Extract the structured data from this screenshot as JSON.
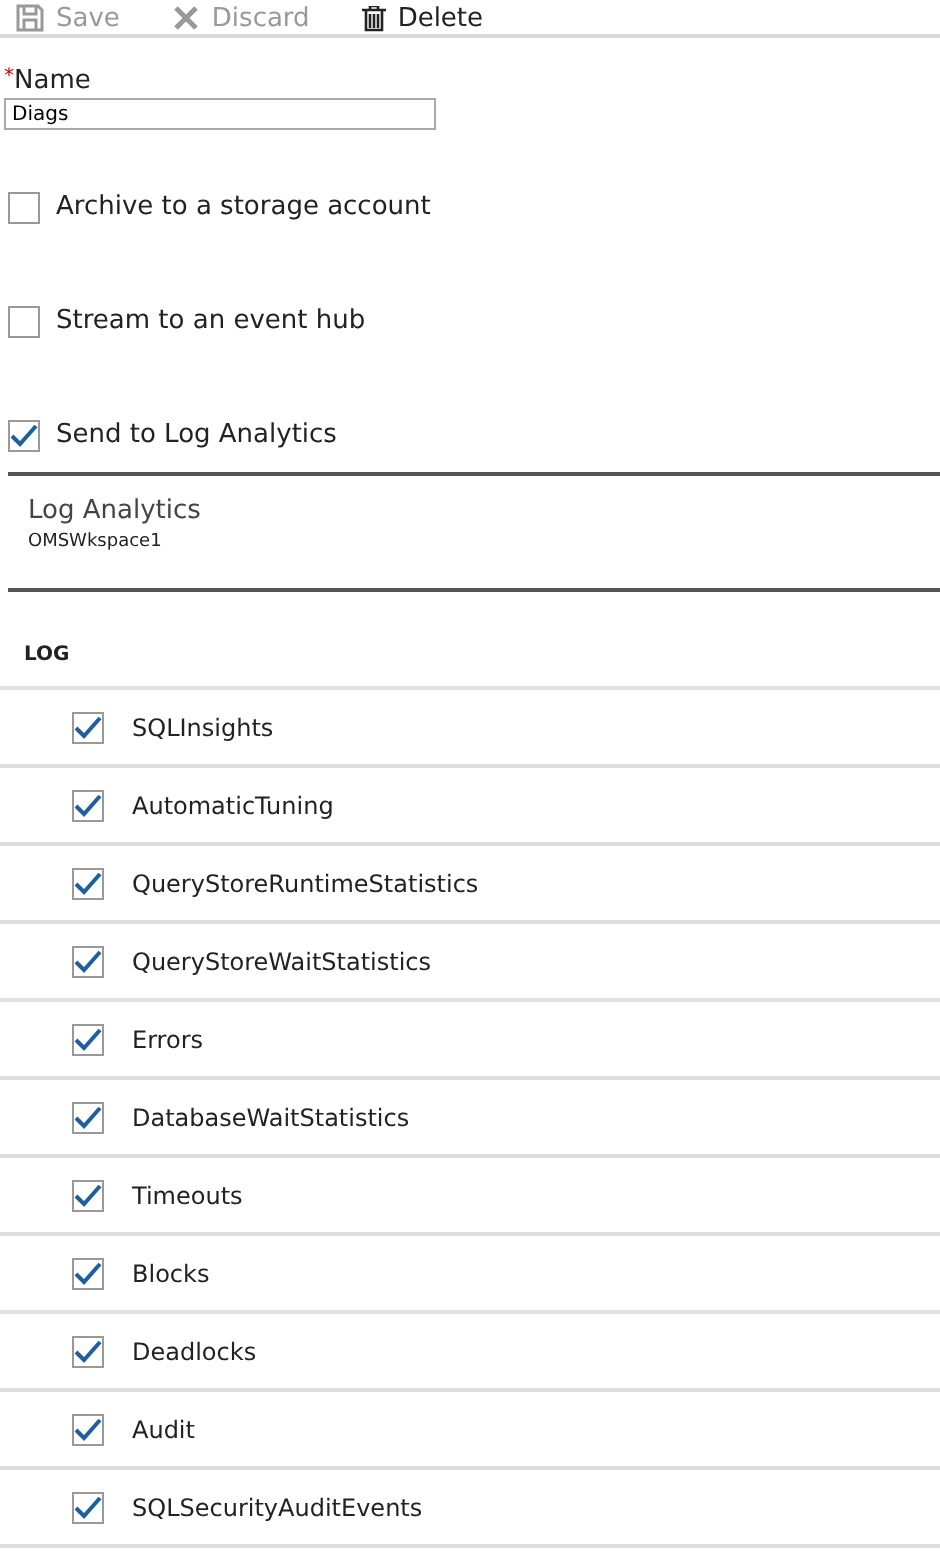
{
  "toolbar": [
    {
      "kind": "save",
      "label": "Save",
      "disabled": true
    },
    {
      "kind": "discard",
      "label": "Discard",
      "disabled": true
    },
    {
      "kind": "delete",
      "label": "Delete",
      "disabled": false
    }
  ],
  "name_field": {
    "label": "Name",
    "required_mark": "*",
    "value": "Diags"
  },
  "destinations": [
    {
      "label": "Archive to a storage account",
      "checked": false
    },
    {
      "label": "Stream to an event hub",
      "checked": false
    },
    {
      "label": "Send to Log Analytics",
      "checked": true
    }
  ],
  "log_analytics": {
    "title": "Log Analytics",
    "workspace": "OMSWkspace1"
  },
  "log": {
    "heading": "LOG",
    "items": [
      {
        "label": "SQLInsights",
        "checked": true
      },
      {
        "label": "AutomaticTuning",
        "checked": true
      },
      {
        "label": "QueryStoreRuntimeStatistics",
        "checked": true
      },
      {
        "label": "QueryStoreWaitStatistics",
        "checked": true
      },
      {
        "label": "Errors",
        "checked": true
      },
      {
        "label": "DatabaseWaitStatistics",
        "checked": true
      },
      {
        "label": "Timeouts",
        "checked": true
      },
      {
        "label": "Blocks",
        "checked": true
      },
      {
        "label": "Deadlocks",
        "checked": true
      },
      {
        "label": "Audit",
        "checked": true
      },
      {
        "label": "SQLSecurityAuditEvents",
        "checked": true
      }
    ]
  }
}
